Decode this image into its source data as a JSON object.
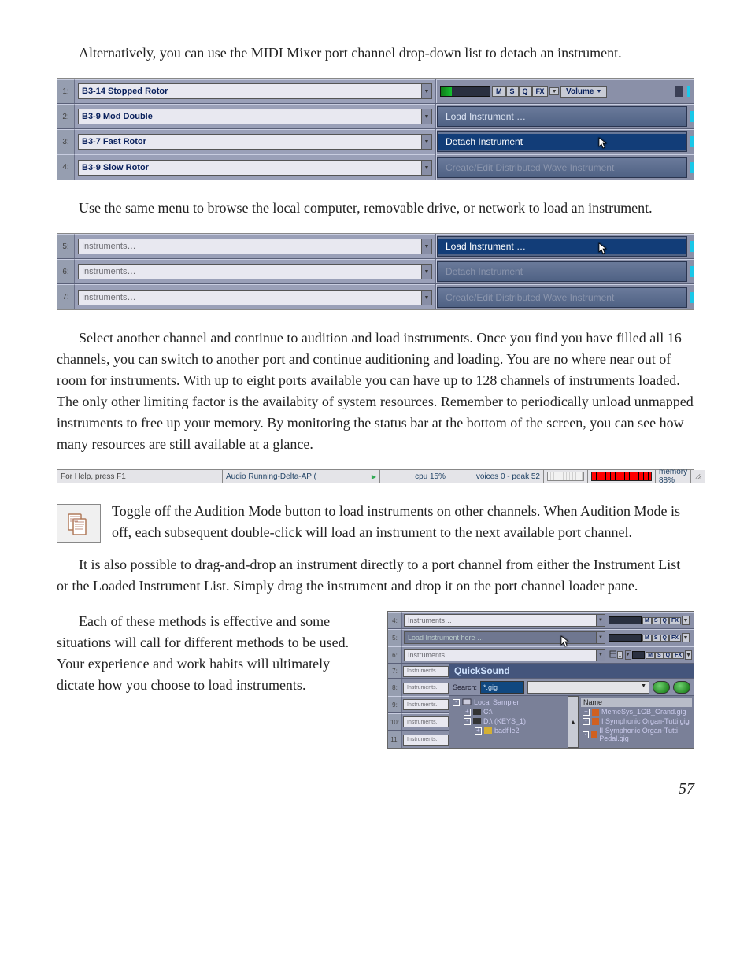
{
  "intro_para": "Alternatively, you can use the MIDI Mixer port channel drop-down list to detach an instrument.",
  "panel1": {
    "rows": [
      {
        "num": "1:",
        "name": "B3-14 Stopped Rotor"
      },
      {
        "num": "2:",
        "name": "B3-9 Mod Double"
      },
      {
        "num": "3:",
        "name": "B3-7 Fast Rotor"
      },
      {
        "num": "4:",
        "name": "B3-9 Slow Rotor"
      }
    ],
    "buttons": {
      "m": "M",
      "s": "S",
      "q": "Q",
      "fx": "FX"
    },
    "volume": "Volume",
    "menu": {
      "load": "Load Instrument …",
      "detach": "Detach Instrument",
      "create": "Create/Edit Distributed Wave Instrument"
    }
  },
  "para2": "Use the same menu to browse the local computer, removable drive, or network to load an instrument.",
  "panel2": {
    "rows": [
      {
        "num": "5:",
        "name": "Instruments…"
      },
      {
        "num": "6:",
        "name": "Instruments…"
      },
      {
        "num": "7:",
        "name": "Instruments…"
      }
    ],
    "menu": {
      "load": "Load Instrument …",
      "detach": "Detach Instrument",
      "create": "Create/Edit Distributed Wave Instrument"
    }
  },
  "para3": "Select another channel and continue to audition and load instruments. Once you find you have filled all 16 channels, you can switch to another port and continue auditioning and loading. You are no where near out of room for instruments. With up to eight ports available you can have up to 128 channels of instruments loaded. The only other limiting factor is the availabity of system resources. Remember to periodically unload unmapped instruments to free up your memory. By monitoring the status bar at the bottom of the screen, you can see how many resources are still available at a glance.",
  "statusbar": {
    "help": "For Help, press F1",
    "audio": "Audio Running-Delta-AP (",
    "cpu": "cpu 15%",
    "voices": "voices 0 - peak 52",
    "memory": "memory 88%"
  },
  "para4": "Toggle off the Audition Mode button to load instruments on other channels. When Audition Mode is off, each subsequent double-click will load an instrument to the next available port channel.",
  "para5": "It is also possible to drag-and-drop an instrument directly to a port channel from either the Instrument List or the Loaded Instrument List. Simply drag the instrument and drop it on the port channel loader pane.",
  "para6": "Each of these methods is effective and some situations will call for different methods to be used. Your experience and work habits will ultimately dictate how you choose to load instruments.",
  "quicksound": {
    "rows_top": [
      {
        "num": "4:",
        "name": "Instruments…"
      },
      {
        "num": "5:",
        "name": "Load Instrument here …"
      },
      {
        "num": "6:",
        "name": "Instruments…"
      }
    ],
    "numbered_left": [
      {
        "num": "7:",
        "t": "Instruments."
      },
      {
        "num": "8:",
        "t": "Instruments."
      },
      {
        "num": "9:",
        "t": "Instruments."
      },
      {
        "num": "10:",
        "t": "Instruments."
      },
      {
        "num": "11:",
        "t": "Instruments."
      }
    ],
    "title": "QuickSound",
    "search_label": "Search:",
    "search_value": "*.gig",
    "tree": {
      "root": "Local Sampler",
      "c": "C:\\",
      "d": "D:\\ (KEYS_1)",
      "bad": "badfile2"
    },
    "list": {
      "header": "Name",
      "items": [
        "MemeSys_1GB_Grand.gig",
        "I Symphonic Organ-Tutti.gig",
        "II Symphonic Organ-Tutti Pedal.gig"
      ]
    }
  },
  "pagenum": "57"
}
